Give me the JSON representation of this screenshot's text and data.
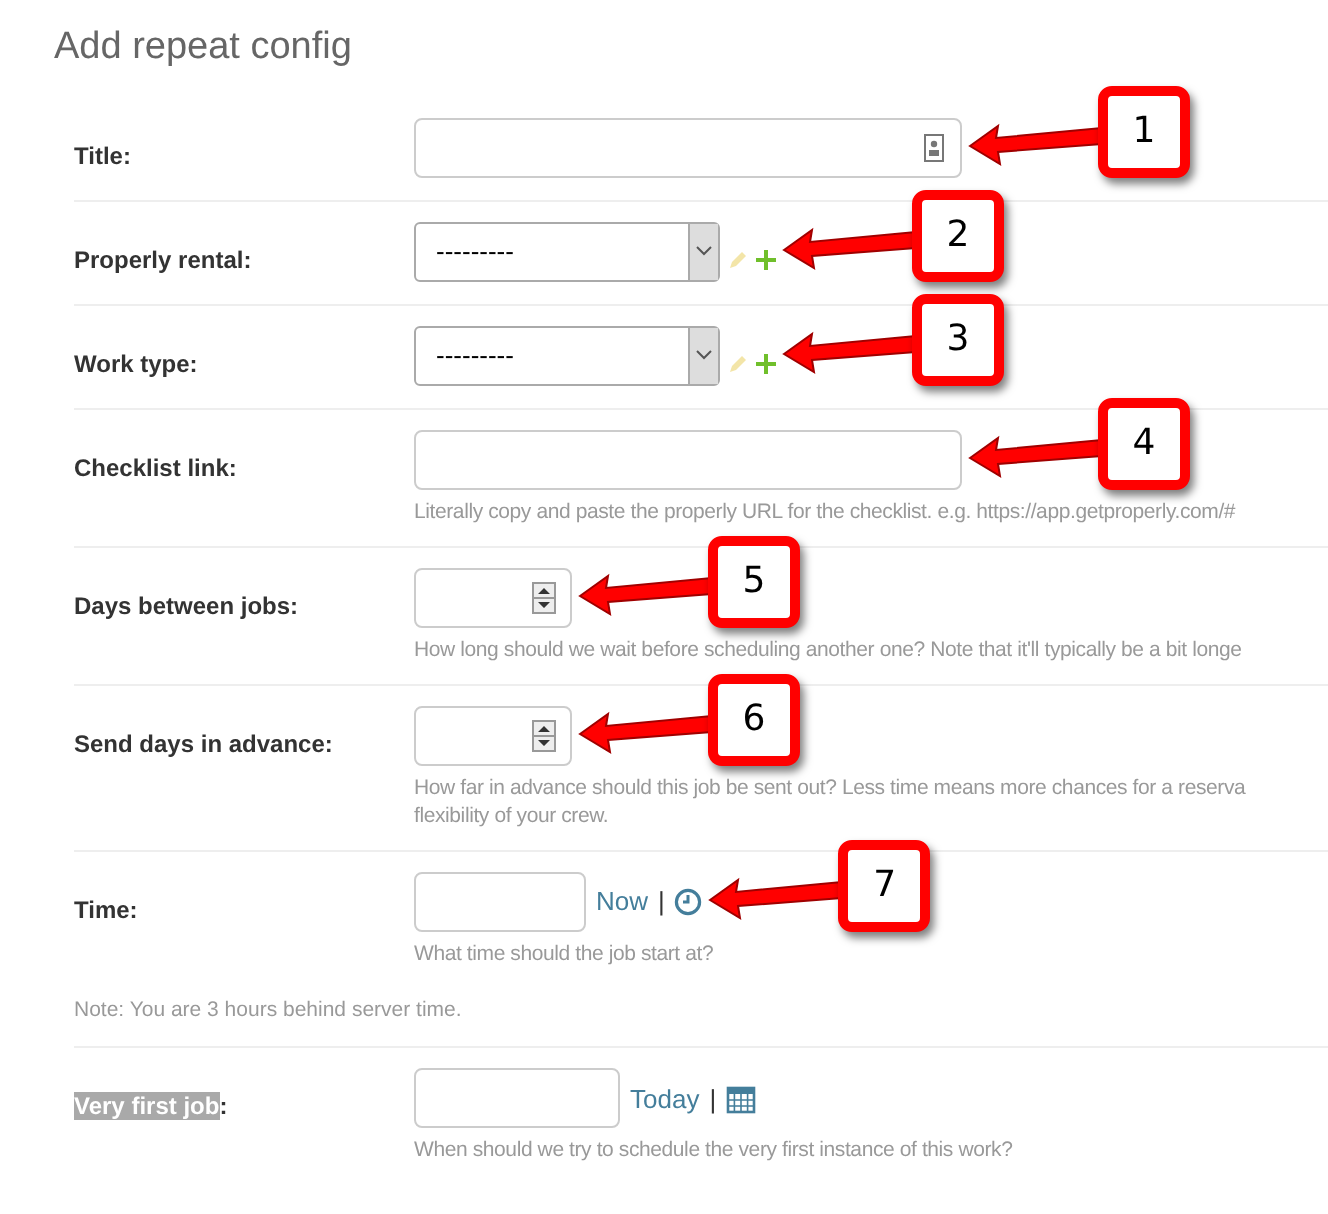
{
  "heading": "Add repeat config",
  "rows": [
    {
      "kind": "text",
      "label": "Title",
      "label_suffix": ":",
      "highlighted": false,
      "callout": "1"
    },
    {
      "kind": "select",
      "label": "Properly rental",
      "label_suffix": ":",
      "highlighted": false,
      "value": "---------",
      "callout": "2"
    },
    {
      "kind": "select",
      "label": "Work type",
      "label_suffix": ":",
      "highlighted": false,
      "value": "---------",
      "callout": "3"
    },
    {
      "kind": "text",
      "label": "Checklist link",
      "label_suffix": ":",
      "highlighted": false,
      "help": [
        "Literally copy and paste the properly URL for the checklist. e.g. https://app.getproperly.com/#"
      ],
      "callout": "4"
    },
    {
      "kind": "number",
      "label": "Days between jobs",
      "label_suffix": ":",
      "highlighted": false,
      "help": [
        "How long should we wait before scheduling another one? Note that it'll typically be a bit longe"
      ],
      "callout": "5"
    },
    {
      "kind": "number",
      "label": "Send days in advance",
      "label_suffix": ":",
      "highlighted": false,
      "help": [
        "How far in advance should this job be sent out? Less time means more chances for a reserva",
        "flexibility of your crew."
      ],
      "callout": "6"
    },
    {
      "kind": "time",
      "label": "Time",
      "label_suffix": ":",
      "highlighted": false,
      "link": "Now",
      "separator": "|",
      "help": [
        "What time should the job start at?"
      ],
      "note": "Note: You are 3 hours behind server time.",
      "callout": "7"
    },
    {
      "kind": "date",
      "label": "Very first job",
      "label_suffix": ":",
      "highlighted": true,
      "link": "Today",
      "separator": "|",
      "help": [
        "When should we try to schedule the very first instance of this work?"
      ]
    }
  ]
}
